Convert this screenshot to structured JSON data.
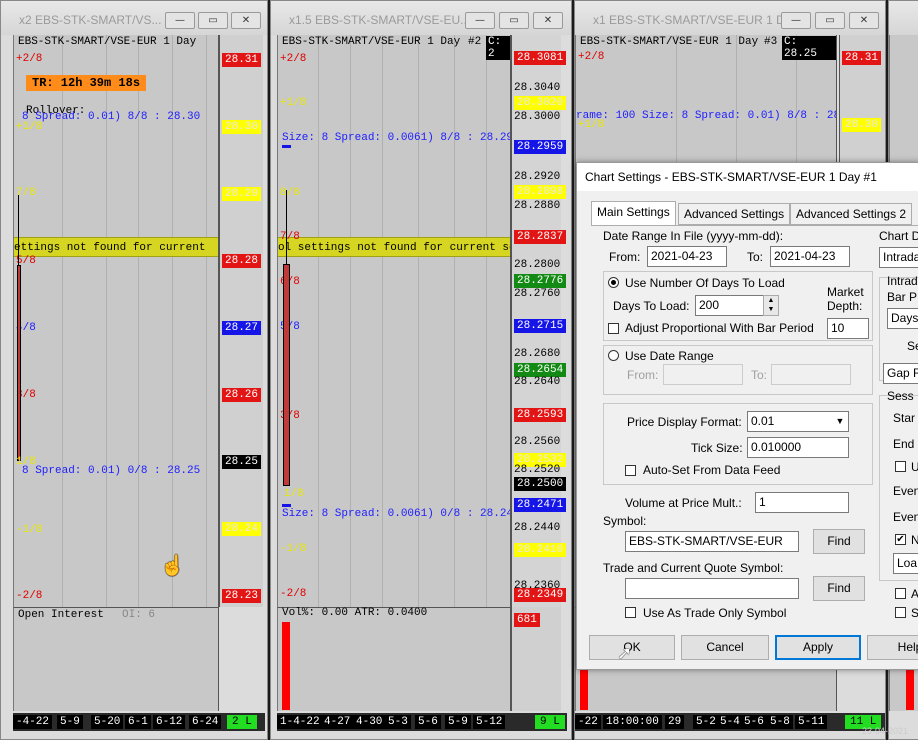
{
  "colors": {
    "red": "#e31414",
    "yellow": "#ffff00",
    "blue": "#1515e8",
    "green": "#22dd22",
    "orange": "#ff8c1a"
  },
  "win1": {
    "title": "x2 EBS-STK-SMART/VS...",
    "header": "EBS-STK-SMART/VSE-EUR  1 Day",
    "timer": "TR: 12h 39m 18s",
    "rollover": "Rollover:",
    "spread_top": "8 Spread: 0.01) 8/8 : 28.30",
    "spread_bottom": "8 Spread: 0.01) 0/8 : 28.25",
    "banner": "ettings not found for current",
    "fractions": [
      "+2/8",
      "+1/8",
      "7/8",
      "6/8",
      "5/8",
      "4/8",
      "3/8",
      "2/8",
      "1/8",
      "-1/8",
      "-2/8"
    ],
    "price_labels": [
      "28.31",
      "28.30",
      "28.29",
      "28.28",
      "28.27",
      "28.26",
      "28.25",
      "28.24",
      "28.23"
    ],
    "oi_label": "Open Interest",
    "oi_value": "OI: 6",
    "dates": [
      "-4-22",
      "5-9",
      "5-20",
      "6-1",
      "6-12",
      "6-24"
    ],
    "status": "2 L"
  },
  "win2": {
    "title": "x1.5 EBS-STK-SMART/VSE-EU...",
    "header": "EBS-STK-SMART/VSE-EUR  1 Day",
    "num": "#2",
    "cbox": "C: 2",
    "banner": "ol settings not found for current serv",
    "spread_top": "Size: 8 Spread: 0.0061) 8/8 : 28.2959",
    "spread_bottom": "Size: 8 Spread: 0.0061) 0/8 : 28.2471",
    "fractions": [
      "+2/8",
      "+1/8",
      "8/8",
      "7/8",
      "6/8",
      "5/8",
      "4/8",
      "3/8",
      "2/8",
      "1/8",
      "-1/8",
      "-2/8"
    ],
    "axis_ticks": [
      "28.3040",
      "28.3000",
      "28.2960",
      "28.2920",
      "28.2880",
      "28.2840",
      "28.2800",
      "28.2760",
      "28.2720",
      "28.2680",
      "28.2640",
      "28.2600",
      "28.2560",
      "28.2520",
      "28.2480",
      "28.2440",
      "28.2400",
      "28.2360"
    ],
    "price_labels": [
      "28.3081",
      "28.3020",
      "28.2959",
      "28.2898",
      "28.2837",
      "28.2776",
      "28.2715",
      "28.2654",
      "28.2593",
      "28.2532",
      "28.2500",
      "28.2471",
      "28.2410",
      "28.2349"
    ],
    "vol_text": "Vol%: 0.00  ATR: 0.0400",
    "vol_label": "681",
    "dates": [
      "1-4-22",
      "4-27",
      "4-30",
      "5-3",
      "5-6",
      "5-9",
      "5-12"
    ],
    "status": "9 L"
  },
  "win3": {
    "title": "x1 EBS-STK-SMART/VSE-EUR  1 D...",
    "header": "EBS-STK-SMART/VSE-EUR  1 Day",
    "num": "#3",
    "cbox": "C: 28.25",
    "spread_top": "rame: 100 Size: 8 Spread: 0.01) 8/8 : 28.30",
    "fractions": [
      "+2/8",
      "+1/8"
    ],
    "price_labels": [
      "28.31",
      "28.30"
    ],
    "dates": [
      "-22",
      "18:00:00",
      "29",
      "5-2",
      "5-4",
      "5-6",
      "5-8",
      "5-11"
    ],
    "status": "11 L",
    "timestamp": "23-04-2021"
  },
  "dialog": {
    "title": "Chart Settings - EBS-STK-SMART/VSE-EUR  1 Day  #1",
    "tabs": [
      "Main Settings",
      "Advanced Settings",
      "Advanced Settings 2"
    ],
    "date_range_label": "Date Range In File (yyyy-mm-dd):",
    "from_label": "From:",
    "from_value": "2021-04-23",
    "to_label": "To:",
    "to_value": "2021-04-23",
    "use_days_label": "Use Number Of Days To Load",
    "days_label": "Days To Load:",
    "days_value": "200",
    "market_depth_label": "Market Depth:",
    "market_depth_value": "10",
    "adjust_label": "Adjust Proportional With Bar Period",
    "use_range_label": "Use Date Range",
    "range_from_label": "From:",
    "range_to_label": "To:",
    "price_format_label": "Price Display Format:",
    "price_format_value": "0.01",
    "tick_size_label": "Tick Size:",
    "tick_size_value": "0.010000",
    "auto_set_label": "Auto-Set From Data Feed",
    "volume_mult_label": "Volume at Price Mult.:",
    "volume_mult_value": "1",
    "symbol_label": "Symbol:",
    "symbol_value": "EBS-STK-SMART/VSE-EUR",
    "find_label": "Find",
    "trade_symbol_label": "Trade and Current Quote Symbol:",
    "trade_symbol_value": "",
    "trade_only_label": "Use As Trade Only Symbol",
    "ok_label": "OK",
    "cancel_label": "Cancel",
    "apply_label": "Apply",
    "help_label": "Help",
    "right_col": {
      "chart_label": "Chart D",
      "intraday": "Intrada",
      "intraday_group": "Intrad",
      "bar_label": "Bar P",
      "days_combo": "Days",
      "s_label": "Se",
      "gap_combo": "Gap F",
      "session_group": "Sess",
      "start": "Star",
      "end": "End",
      "u": "U",
      "eve1": "Even",
      "eve2": "Even",
      "n": "N",
      "load": "Loa",
      "a": "A",
      "s": "S"
    }
  }
}
